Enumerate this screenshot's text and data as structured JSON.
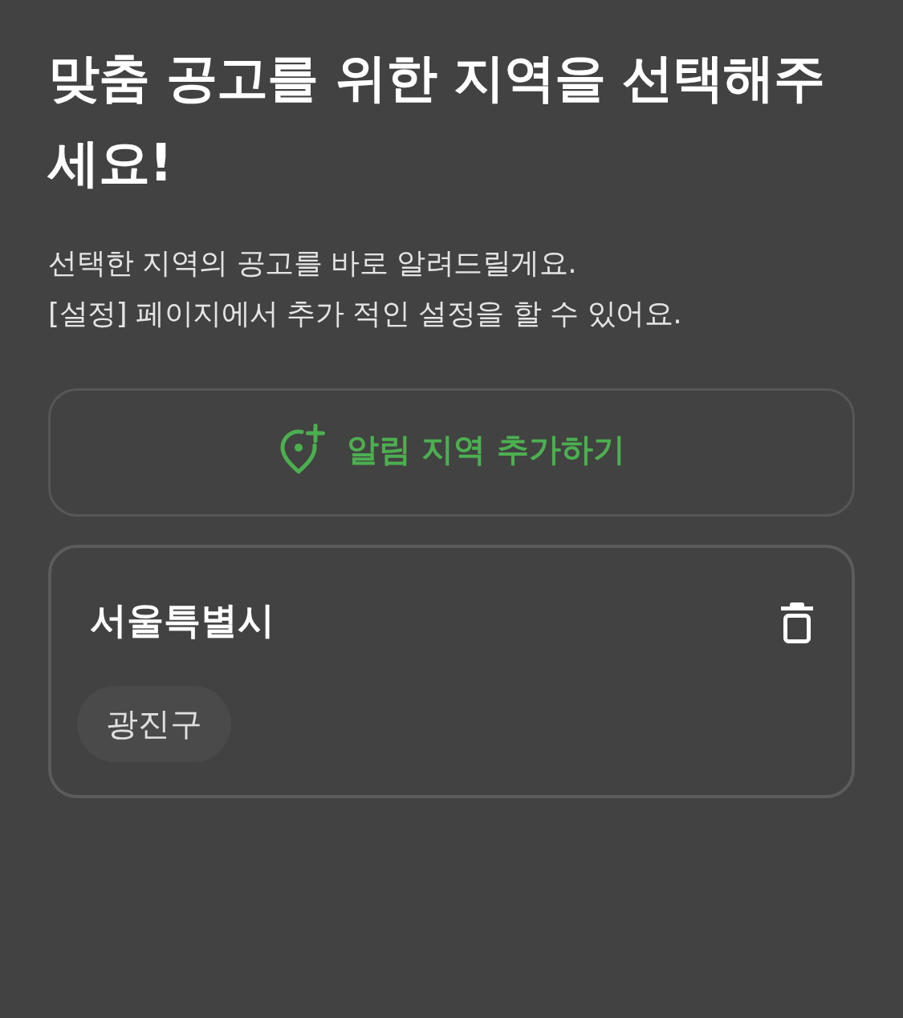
{
  "heading": "맞춤 공고를 위한 지역을 선택해주세요!",
  "description": "선택한 지역의 공고를 바로 알려드릴게요.\n[설정] 페이지에서 추가 적인 설정을 할 수 있어요.",
  "add_button": {
    "label": "알림 지역 추가하기"
  },
  "regions": [
    {
      "name": "서울특별시",
      "districts": [
        "광진구"
      ]
    }
  ]
}
